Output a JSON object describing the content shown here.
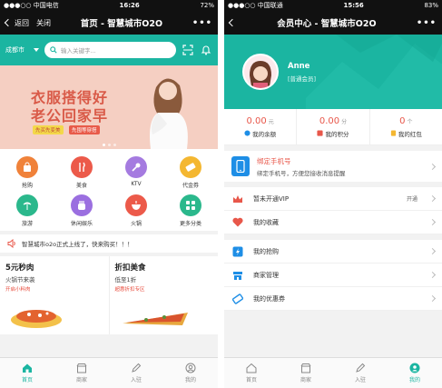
{
  "left": {
    "status": {
      "carrier": "●●●○○ 中国电信",
      "time": "16:26",
      "battery": "72%"
    },
    "nav": {
      "back": "返回",
      "close": "关闭",
      "title": "首页 - 智慧城市O2O",
      "more": "•••"
    },
    "city": "成都市",
    "search_placeholder": "输入关键字...",
    "banner": {
      "line1": "衣服搭得好",
      "line2": "老公回家早",
      "tag1": "先买先变美",
      "tag2": "先囤等穿搭"
    },
    "categories": [
      {
        "label": "抢购",
        "color": "#f0823a",
        "icon": "shopping-bag-icon"
      },
      {
        "label": "美食",
        "color": "#ec5a4a",
        "icon": "fork-knife-icon"
      },
      {
        "label": "KTV",
        "color": "#a57be0",
        "icon": "microphone-icon"
      },
      {
        "label": "代金券",
        "color": "#f4b731",
        "icon": "ticket-icon"
      },
      {
        "label": "旅游",
        "color": "#2bb88c",
        "icon": "palm-tree-icon"
      },
      {
        "label": "休闲娱乐",
        "color": "#9b6fe0",
        "icon": "hand-icon"
      },
      {
        "label": "火锅",
        "color": "#ec5a4a",
        "icon": "hotpot-icon"
      },
      {
        "label": "更多分类",
        "color": "#2bb88c",
        "icon": "grid-icon"
      }
    ],
    "notice": "智慧城市o2o正式上线了，快来购买！！！",
    "deals": [
      {
        "title": "5元秒肉",
        "sub": "火锅节来袭",
        "red": "开启小料肉"
      },
      {
        "title": "折扣美食",
        "sub": "低至1折",
        "red": "超惠折扣专区"
      }
    ],
    "tabs": [
      {
        "label": "首页",
        "icon": "home-icon",
        "active": true
      },
      {
        "label": "商家",
        "icon": "store-icon",
        "active": false
      },
      {
        "label": "入驻",
        "icon": "pen-icon",
        "active": false
      },
      {
        "label": "我的",
        "icon": "user-icon",
        "active": false
      }
    ]
  },
  "right": {
    "status": {
      "carrier": "●●●○○ 中国联通",
      "time": "15:56",
      "battery": "83%"
    },
    "nav": {
      "back": "",
      "title": "会员中心 - 智慧城市O2O",
      "more": "•••"
    },
    "profile": {
      "name": "Anne",
      "level": "[普通会员]"
    },
    "stats": [
      {
        "value": "0.00",
        "unit": "元",
        "label": "我的余额",
        "icon": "wallet-icon",
        "icon_color": "#1e8ee6"
      },
      {
        "value": "0.00",
        "unit": "分",
        "label": "我的积分",
        "icon": "points-icon",
        "icon_color": "#e8574a"
      },
      {
        "value": "0",
        "unit": "个",
        "label": "我的红包",
        "icon": "red-packet-icon",
        "icon_color": "#f4b731"
      }
    ],
    "bind": {
      "title": "绑定手机号",
      "sub": "绑定手机号，方便您接收消息提醒"
    },
    "menu1": [
      {
        "label": "暂未开通VIP",
        "extra": "开通",
        "icon": "crown-icon",
        "color": "#e8574a"
      },
      {
        "label": "我的收藏",
        "extra": "",
        "icon": "heart-icon",
        "color": "#e8574a"
      }
    ],
    "menu2": [
      {
        "label": "我的抢购",
        "icon": "flash-sale-icon",
        "color": "#1e8ee6"
      },
      {
        "label": "商家管理",
        "icon": "store-manage-icon",
        "color": "#1e8ee6"
      },
      {
        "label": "我的优惠券",
        "icon": "coupon-icon",
        "color": "#1e8ee6"
      }
    ],
    "tabs": [
      {
        "label": "首页",
        "icon": "home-icon",
        "active": false
      },
      {
        "label": "商家",
        "icon": "store-icon",
        "active": false
      },
      {
        "label": "入驻",
        "icon": "pen-icon",
        "active": false
      },
      {
        "label": "我的",
        "icon": "user-icon",
        "active": true
      }
    ]
  }
}
